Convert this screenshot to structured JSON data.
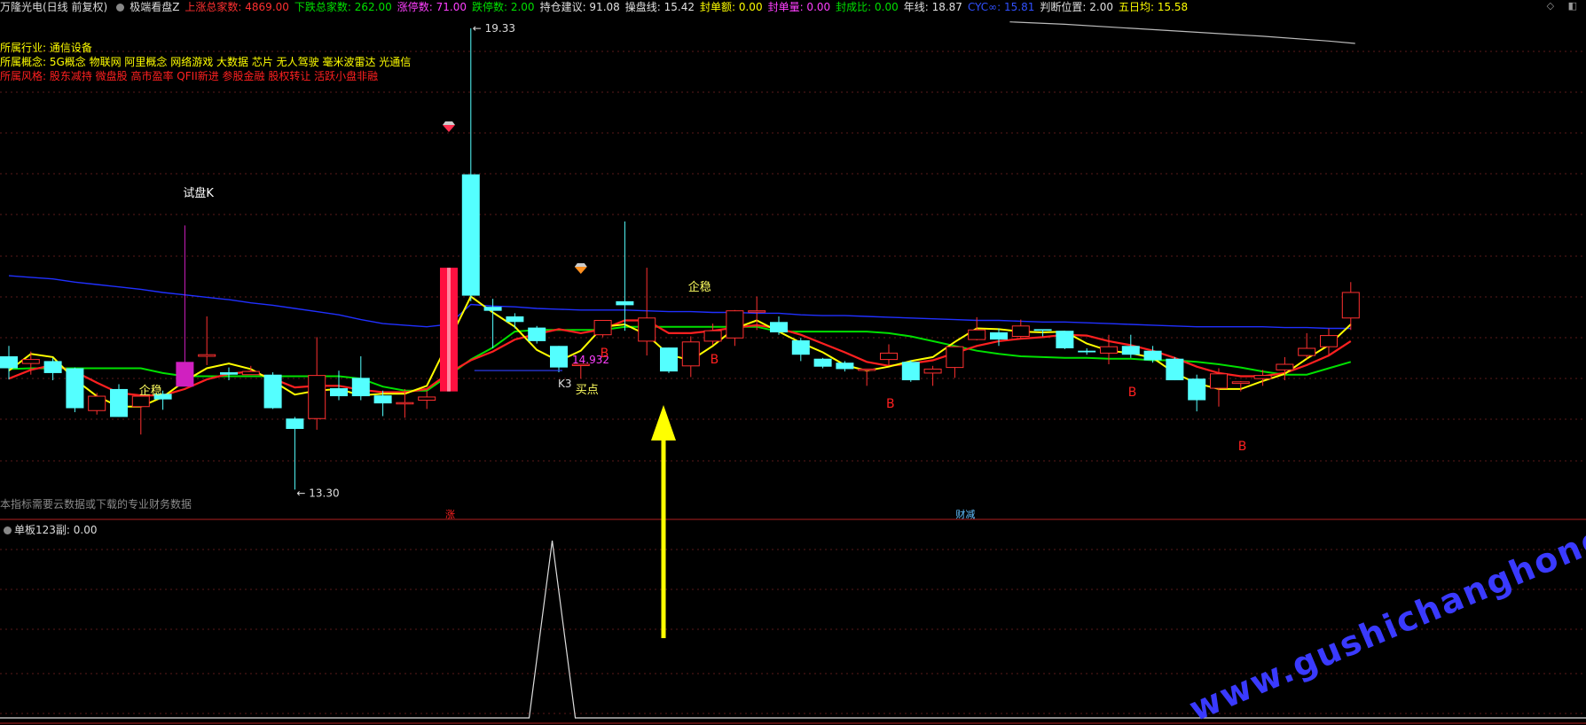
{
  "header": {
    "stock_title": "万隆光电(日线 前复权)",
    "indicator_name": "极端看盘Z",
    "stats": [
      {
        "label": "上涨总家数:",
        "value": "4869.00",
        "color": "#ff3030"
      },
      {
        "label": "下跌总家数:",
        "value": "262.00",
        "color": "#00e000"
      },
      {
        "label": "涨停数:",
        "value": "71.00",
        "color": "#ff40ff"
      },
      {
        "label": "跌停数:",
        "value": "2.00",
        "color": "#00e000"
      },
      {
        "label": "持仓建议:",
        "value": "91.08",
        "color": "#e0e0e0"
      },
      {
        "label": "操盘线:",
        "value": "15.42",
        "color": "#e0e0e0"
      },
      {
        "label": "封单额:",
        "value": "0.00",
        "color": "#ffff00"
      },
      {
        "label": "封单量:",
        "value": "0.00",
        "color": "#ff40ff"
      },
      {
        "label": "封成比:",
        "value": "0.00",
        "color": "#00e000"
      },
      {
        "label": "年线:",
        "value": "18.87",
        "color": "#e0e0e0"
      },
      {
        "label": "CYC∞:",
        "value": "15.81",
        "color": "#3050ff"
      },
      {
        "label": "判断位置:",
        "value": "2.00",
        "color": "#e0e0e0"
      },
      {
        "label": "五日均:",
        "value": "15.58",
        "color": "#ffff00"
      }
    ],
    "corner_icons": "◇ ◧"
  },
  "info_lines": [
    {
      "label": "所属行业:",
      "text": "通信设备",
      "color": "#ffff00"
    },
    {
      "label": "所属概念:",
      "text": "5G概念 物联网 阿里概念 网络游戏 大数据 芯片 无人驾驶 毫米波雷达 光通信",
      "color": "#ffff00"
    },
    {
      "label": "所属风格:",
      "text": "股东减持 微盘股 高市盈率 QFII新进 参股金融 股权转让 活跃小盘非融",
      "color": "#ff2020"
    }
  ],
  "footnote": "本指标需要云数据或下载的专业财务数据",
  "sub_panel": {
    "title": "单板123副",
    "value": ": 0.00"
  },
  "watermark": "www.gushichanghong.com",
  "colors": {
    "up": "#ff3030",
    "down": "#54ffff",
    "ma5": "#ffff00",
    "ma10": "#ff2020",
    "ma20": "#00e000",
    "ma60": "#2030ff"
  },
  "chart_data": {
    "type": "candlestick",
    "y_labels": {
      "high": "19.33",
      "low": "13.30",
      "line_value": "14.932"
    },
    "annotations": {
      "trial_k": "试盘K",
      "stable": "企稳",
      "buy_point": "买点",
      "k3": "K3",
      "b_mark": "B",
      "limit_up": "涨",
      "finance": "财减"
    },
    "candles": [
      {
        "o": 15.11,
        "c": 14.96,
        "h": 15.24,
        "l": 14.82
      },
      {
        "o": 15.02,
        "c": 15.07,
        "h": 15.17,
        "l": 14.88
      },
      {
        "o": 15.05,
        "c": 14.9,
        "h": 15.09,
        "l": 14.81
      },
      {
        "o": 14.96,
        "c": 14.46,
        "h": 14.97,
        "l": 14.41
      },
      {
        "o": 14.43,
        "c": 14.61,
        "h": 14.65,
        "l": 14.38
      },
      {
        "o": 14.7,
        "c": 14.35,
        "h": 14.76,
        "l": 14.35
      },
      {
        "o": 14.48,
        "c": 14.61,
        "h": 14.64,
        "l": 14.13
      },
      {
        "o": 14.64,
        "c": 14.57,
        "h": 14.68,
        "l": 14.44
      },
      {
        "o": 14.73,
        "c": 15.04,
        "h": 16.75,
        "l": 14.84
      },
      {
        "o": 15.11,
        "c": 15.13,
        "h": 15.61,
        "l": 15.0
      },
      {
        "o": 14.91,
        "c": 14.88,
        "h": 14.97,
        "l": 14.81
      },
      {
        "o": 14.88,
        "c": 14.92,
        "h": 14.99,
        "l": 14.88
      },
      {
        "o": 14.88,
        "c": 14.46,
        "h": 14.91,
        "l": 14.45
      },
      {
        "o": 14.33,
        "c": 14.2,
        "h": 14.35,
        "l": 13.44
      },
      {
        "o": 14.33,
        "c": 14.87,
        "h": 15.35,
        "l": 14.19
      },
      {
        "o": 14.71,
        "c": 14.61,
        "h": 14.93,
        "l": 14.56
      },
      {
        "o": 14.84,
        "c": 14.61,
        "h": 15.11,
        "l": 14.56
      },
      {
        "o": 14.62,
        "c": 14.52,
        "h": 14.68,
        "l": 14.36
      },
      {
        "o": 14.53,
        "c": 14.53,
        "h": 14.7,
        "l": 14.34
      },
      {
        "o": 14.56,
        "c": 14.6,
        "h": 14.68,
        "l": 14.45
      },
      {
        "o": 14.67,
        "c": 16.22,
        "h": 16.22,
        "l": 14.67
      },
      {
        "o": 17.39,
        "c": 15.87,
        "h": 19.22,
        "l": 15.8
      },
      {
        "o": 15.73,
        "c": 15.68,
        "h": 15.83,
        "l": 15.21
      },
      {
        "o": 15.61,
        "c": 15.54,
        "h": 15.65,
        "l": 15.46
      },
      {
        "o": 15.47,
        "c": 15.3,
        "h": 15.49,
        "l": 15.27
      },
      {
        "o": 15.24,
        "c": 14.97,
        "h": 15.24,
        "l": 14.91
      },
      {
        "o": 15.01,
        "c": 15.01,
        "h": 15.01,
        "l": 14.83
      },
      {
        "o": 15.38,
        "c": 15.56,
        "h": 15.56,
        "l": 15.35
      },
      {
        "o": 15.8,
        "c": 15.75,
        "h": 16.8,
        "l": 15.43
      },
      {
        "o": 15.3,
        "c": 15.59,
        "h": 16.22,
        "l": 15.12
      },
      {
        "o": 15.22,
        "c": 14.92,
        "h": 15.22,
        "l": 14.9
      },
      {
        "o": 14.99,
        "c": 15.29,
        "h": 15.36,
        "l": 14.85
      },
      {
        "o": 15.3,
        "c": 15.43,
        "h": 15.52,
        "l": 15.25
      },
      {
        "o": 15.34,
        "c": 15.68,
        "h": 15.69,
        "l": 15.24
      },
      {
        "o": 15.67,
        "c": 15.68,
        "h": 15.86,
        "l": 15.44
      },
      {
        "o": 15.54,
        "c": 15.41,
        "h": 15.61,
        "l": 15.38
      },
      {
        "o": 15.31,
        "c": 15.13,
        "h": 15.34,
        "l": 15.05
      },
      {
        "o": 15.08,
        "c": 14.98,
        "h": 15.09,
        "l": 14.96
      },
      {
        "o": 15.03,
        "c": 14.95,
        "h": 15.05,
        "l": 14.92
      },
      {
        "o": 14.95,
        "c": 14.95,
        "h": 14.95,
        "l": 14.74
      },
      {
        "o": 15.07,
        "c": 15.15,
        "h": 15.26,
        "l": 15.0
      },
      {
        "o": 15.04,
        "c": 14.81,
        "h": 15.06,
        "l": 14.79
      },
      {
        "o": 14.9,
        "c": 14.95,
        "h": 14.99,
        "l": 14.74
      },
      {
        "o": 14.97,
        "c": 15.23,
        "h": 15.24,
        "l": 14.84
      },
      {
        "o": 15.32,
        "c": 15.44,
        "h": 15.6,
        "l": 15.31
      },
      {
        "o": 15.41,
        "c": 15.32,
        "h": 15.46,
        "l": 15.24
      },
      {
        "o": 15.36,
        "c": 15.49,
        "h": 15.57,
        "l": 15.33
      },
      {
        "o": 15.45,
        "c": 15.43,
        "h": 15.44,
        "l": 15.36
      },
      {
        "o": 15.43,
        "c": 15.21,
        "h": 15.43,
        "l": 15.2
      },
      {
        "o": 15.18,
        "c": 15.16,
        "h": 15.21,
        "l": 15.13
      },
      {
        "o": 15.15,
        "c": 15.23,
        "h": 15.38,
        "l": 15.01
      },
      {
        "o": 15.24,
        "c": 15.13,
        "h": 15.38,
        "l": 15.09
      },
      {
        "o": 15.18,
        "c": 15.06,
        "h": 15.24,
        "l": 15.03
      },
      {
        "o": 15.08,
        "c": 14.81,
        "h": 15.1,
        "l": 14.81
      },
      {
        "o": 14.83,
        "c": 14.56,
        "h": 14.88,
        "l": 14.42
      },
      {
        "o": 14.71,
        "c": 14.89,
        "h": 14.96,
        "l": 14.48
      },
      {
        "o": 14.77,
        "c": 14.79,
        "h": 14.8,
        "l": 14.67
      },
      {
        "o": 14.83,
        "c": 14.87,
        "h": 14.94,
        "l": 14.74
      },
      {
        "o": 14.94,
        "c": 15.01,
        "h": 15.1,
        "l": 14.81
      },
      {
        "o": 15.12,
        "c": 15.21,
        "h": 15.4,
        "l": 15.08
      },
      {
        "o": 15.23,
        "c": 15.37,
        "h": 15.46,
        "l": 15.13
      },
      {
        "o": 15.59,
        "c": 15.91,
        "h": 16.04,
        "l": 15.44
      }
    ],
    "ma5": [
      14.93,
      15.14,
      15.1,
      14.82,
      14.61,
      14.48,
      14.48,
      14.6,
      14.8,
      14.96,
      15.02,
      14.95,
      14.8,
      14.63,
      14.68,
      14.7,
      14.62,
      14.64,
      14.64,
      14.74,
      15.3,
      15.86,
      15.66,
      15.48,
      15.19,
      15.05,
      15.18,
      15.48,
      15.51,
      15.38,
      15.13,
      15.06,
      15.24,
      15.46,
      15.56,
      15.42,
      15.28,
      15.16,
      15.0,
      14.93,
      14.98,
      15.05,
      15.1,
      15.29,
      15.46,
      15.45,
      15.42,
      15.41,
      15.42,
      15.27,
      15.18,
      15.15,
      15.09,
      14.9,
      14.77,
      14.7,
      14.7,
      14.8,
      14.89,
      15.08,
      15.25,
      15.51
    ],
    "ma10": [
      14.83,
      14.94,
      15.0,
      14.92,
      14.78,
      14.65,
      14.62,
      14.62,
      14.7,
      14.82,
      14.89,
      14.92,
      14.83,
      14.72,
      14.74,
      14.74,
      14.69,
      14.66,
      14.66,
      14.7,
      14.9,
      15.06,
      15.17,
      15.32,
      15.39,
      15.45,
      15.4,
      15.45,
      15.56,
      15.56,
      15.4,
      15.4,
      15.43,
      15.47,
      15.5,
      15.46,
      15.38,
      15.27,
      15.16,
      15.04,
      14.99,
      15.02,
      15.06,
      15.15,
      15.24,
      15.3,
      15.33,
      15.35,
      15.38,
      15.37,
      15.3,
      15.25,
      15.18,
      15.09,
      14.98,
      14.9,
      14.86,
      14.86,
      14.9,
      15.0,
      15.12,
      15.3
    ],
    "ma20": [
      14.95,
      14.96,
      14.96,
      14.96,
      14.96,
      14.96,
      14.96,
      14.9,
      14.86,
      14.86,
      14.86,
      14.86,
      14.86,
      14.86,
      14.86,
      14.86,
      14.83,
      14.73,
      14.68,
      14.68,
      14.87,
      15.07,
      15.22,
      15.42,
      15.44,
      15.44,
      15.44,
      15.44,
      15.48,
      15.48,
      15.48,
      15.48,
      15.48,
      15.48,
      15.48,
      15.42,
      15.42,
      15.42,
      15.42,
      15.42,
      15.4,
      15.36,
      15.3,
      15.24,
      15.18,
      15.14,
      15.11,
      15.1,
      15.09,
      15.09,
      15.08,
      15.08,
      15.06,
      15.06,
      15.04,
      15.01,
      14.97,
      14.92,
      14.88,
      14.88,
      14.96,
      15.04
    ],
    "ma60": [
      16.12,
      16.1,
      16.08,
      16.04,
      16.01,
      15.98,
      15.95,
      15.91,
      15.88,
      15.85,
      15.82,
      15.78,
      15.75,
      15.71,
      15.67,
      15.63,
      15.57,
      15.52,
      15.5,
      15.48,
      15.51,
      15.76,
      15.74,
      15.73,
      15.71,
      15.7,
      15.69,
      15.69,
      15.69,
      15.68,
      15.67,
      15.67,
      15.66,
      15.66,
      15.65,
      15.65,
      15.63,
      15.62,
      15.62,
      15.61,
      15.6,
      15.59,
      15.58,
      15.57,
      15.56,
      15.56,
      15.55,
      15.54,
      15.54,
      15.53,
      15.52,
      15.51,
      15.5,
      15.49,
      15.48,
      15.48,
      15.48,
      15.48,
      15.47,
      15.47,
      15.46,
      15.46
    ],
    "year_line": [
      {
        "i": 45.5,
        "v": 19.3
      },
      {
        "i": 48,
        "v": 19.27
      },
      {
        "i": 51,
        "v": 19.22
      },
      {
        "i": 54,
        "v": 19.17
      },
      {
        "i": 57,
        "v": 19.12
      },
      {
        "i": 60,
        "v": 19.06
      },
      {
        "i": 61.2,
        "v": 19.03
      }
    ],
    "sub_series": {
      "peak_index": 24.7,
      "peak_value": 1.0
    }
  }
}
